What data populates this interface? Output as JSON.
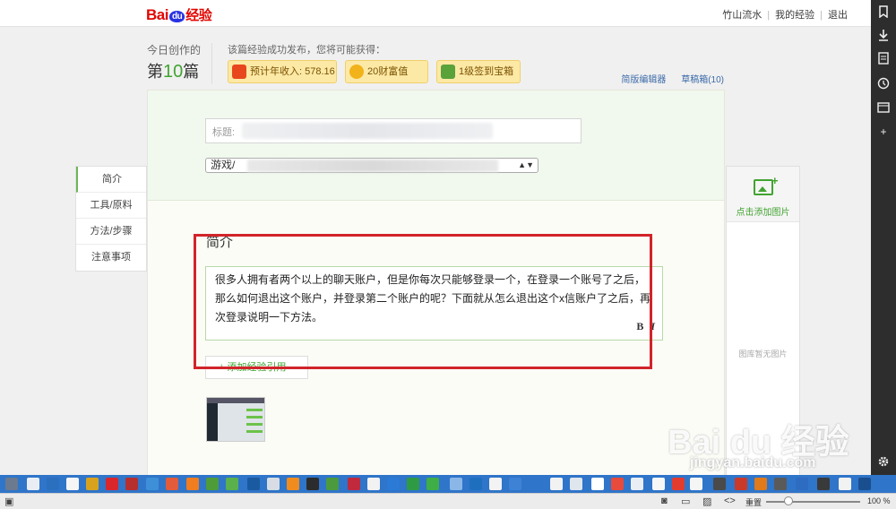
{
  "header": {
    "user_links": [
      "竹山流水",
      "我的经验",
      "退出"
    ]
  },
  "stats": {
    "today_label": "今日创作的",
    "today_prefix": "第",
    "today_count": "10",
    "today_suffix": "篇",
    "publish_label": "该篇经验成功发布，您将可能获得：",
    "badges": [
      {
        "label": "预计年收入: 578.16",
        "color": "#e8461c"
      },
      {
        "label": "20财富值",
        "color": "#f2b21a"
      },
      {
        "label": "1级签到宝箱",
        "color": "#5aa23a"
      }
    ],
    "editor_links": [
      "简版编辑器",
      "草稿箱(10)"
    ]
  },
  "left_nav": {
    "items": [
      {
        "label": "简介"
      },
      {
        "label": "工具/原料"
      },
      {
        "label": "方法/步骤"
      },
      {
        "label": "注意事项"
      }
    ]
  },
  "editor": {
    "title_label": "标题:",
    "category_prefix": "游戏/",
    "intro_heading": "简介",
    "intro_text": "很多人拥有者两个以上的聊天账户，但是你每次只能够登录一个，在登录一个账号了之后，那么如何退出这个账户，并登录第二个账户的呢？下面就从怎么退出这个x信账户了之后，再次登录说明一下方法。",
    "bold_label": "B",
    "italic_label": "I",
    "add_reference": "+ 添加经验引用"
  },
  "image_panel": {
    "add_label": "点击添加图片",
    "empty_label": "图库暂无图片"
  },
  "watermark": {
    "brand": "Bai du 经验",
    "url": "jingyan.baidu.com"
  },
  "statusbar": {
    "mode_label": "重置",
    "zoom": "100 %"
  },
  "colors": {
    "accent": "#42a331",
    "highlight": "#d1242a",
    "taskbar": "#2f75c9"
  }
}
